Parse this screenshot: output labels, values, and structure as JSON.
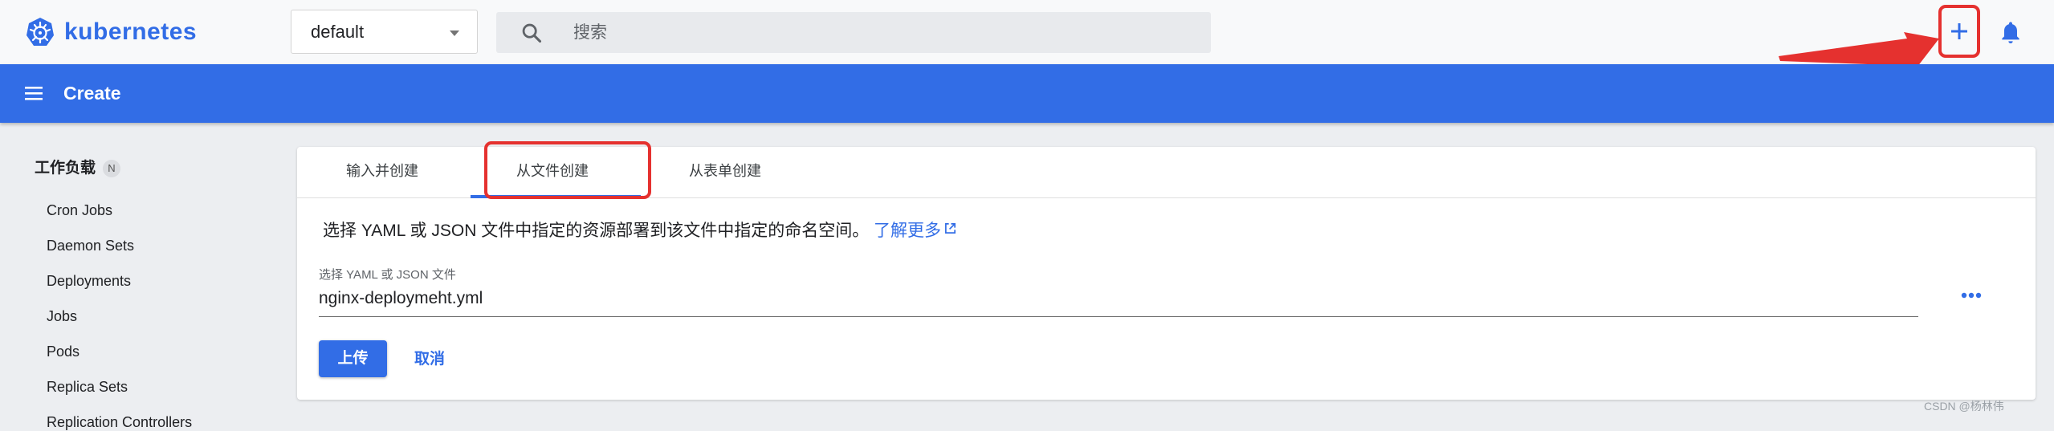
{
  "app": {
    "name": "kubernetes"
  },
  "namespace": {
    "selected": "default"
  },
  "search": {
    "placeholder": "搜索"
  },
  "header": {
    "title": "Create"
  },
  "sidebar": {
    "section": "工作负载",
    "badge": "N",
    "items": [
      "Cron Jobs",
      "Daemon Sets",
      "Deployments",
      "Jobs",
      "Pods",
      "Replica Sets",
      "Replication Controllers"
    ]
  },
  "tabs": [
    "输入并创建",
    "从文件创建",
    "从表单创建"
  ],
  "active_tab": "从文件创建",
  "content": {
    "description": "选择 YAML 或 JSON 文件中指定的资源部署到该文件中指定的命名空间。",
    "learn_more": "了解更多",
    "file_label": "选择 YAML 或 JSON 文件",
    "file_value": "nginx-deploymeht.yml",
    "upload_label": "上传",
    "cancel_label": "取消"
  },
  "watermark": "CSDN @杨林伟",
  "colors": {
    "brand": "#326de6",
    "annotation": "#e5312f"
  },
  "icons": [
    "kubernetes-logo-icon",
    "chevron-down-icon",
    "search-icon",
    "plus-icon",
    "bell-icon",
    "menu-icon",
    "external-link-icon",
    "more-horiz-icon"
  ]
}
